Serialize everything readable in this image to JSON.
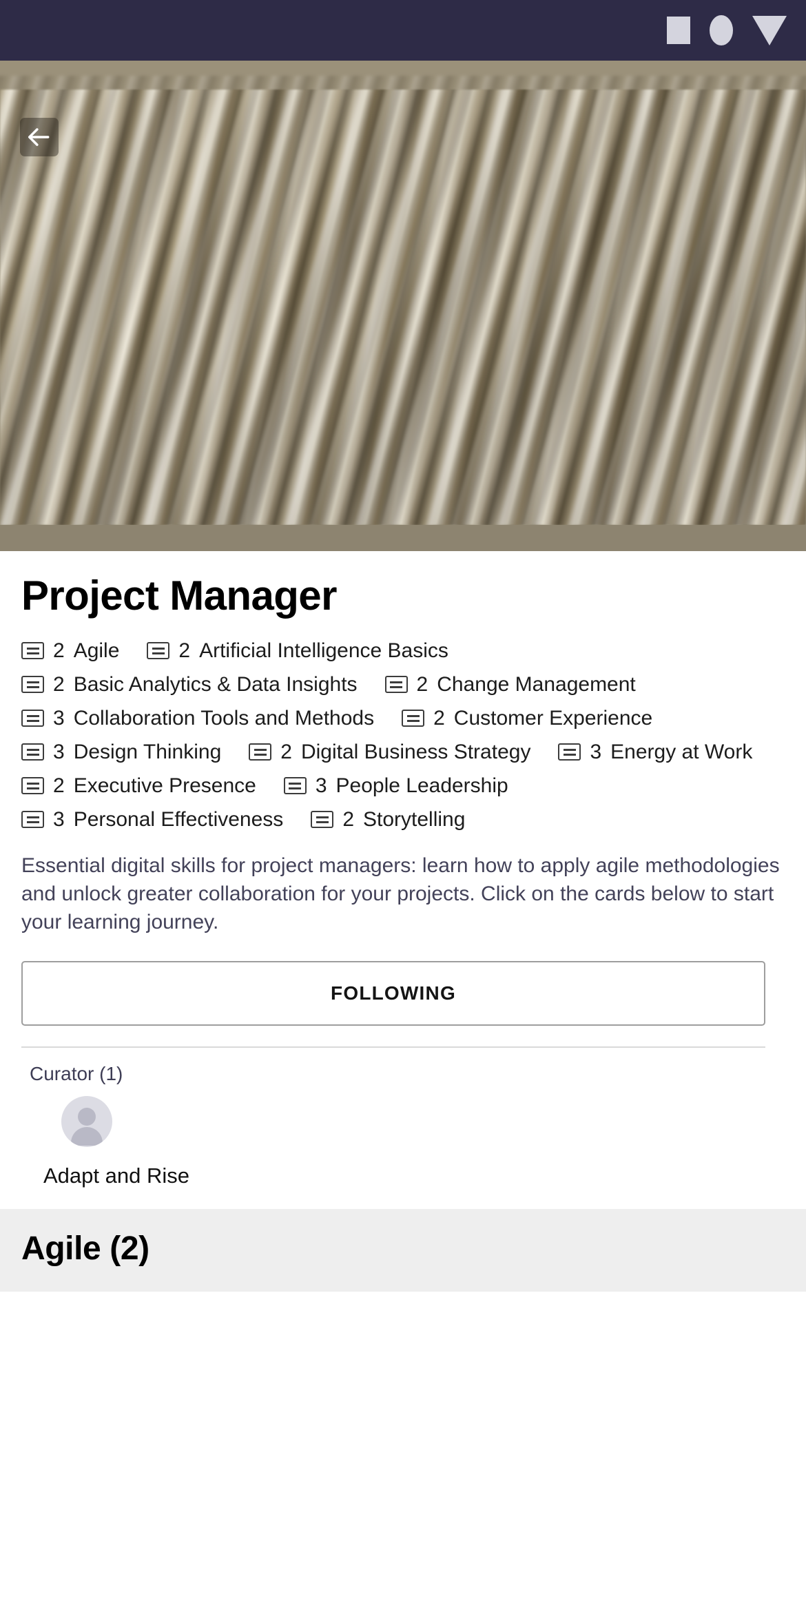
{
  "statusbar": {
    "background_color": "#2e2b47",
    "icons": [
      "square-icon",
      "circle-icon",
      "triangle-down-icon"
    ]
  },
  "hero": {
    "image_description": "sand ripples",
    "back_button_label": "Back",
    "back_icon": "arrow-left-icon"
  },
  "page": {
    "title": "Project Manager",
    "description": "Essential digital skills for project managers: learn how to apply agile methodologies and unlock greater collaboration for your projects. Click on the cards below to start your learning journey.",
    "accent_text_color": "#434259"
  },
  "skills": [
    {
      "count": "2",
      "label": "Agile"
    },
    {
      "count": "2",
      "label": "Artificial Intelligence Basics"
    },
    {
      "count": "2",
      "label": "Basic Analytics & Data Insights"
    },
    {
      "count": "2",
      "label": "Change Management"
    },
    {
      "count": "3",
      "label": "Collaboration Tools and Methods"
    },
    {
      "count": "2",
      "label": "Customer Experience"
    },
    {
      "count": "3",
      "label": "Design Thinking"
    },
    {
      "count": "2",
      "label": "Digital Business Strategy"
    },
    {
      "count": "3",
      "label": "Energy at Work"
    },
    {
      "count": "2",
      "label": "Executive Presence"
    },
    {
      "count": "3",
      "label": "People Leadership"
    },
    {
      "count": "3",
      "label": "Personal Effectiveness"
    },
    {
      "count": "2",
      "label": "Storytelling"
    }
  ],
  "follow": {
    "label": "FOLLOWING"
  },
  "curator": {
    "heading": "Curator (1)",
    "name": "Adapt and Rise",
    "avatar_icon": "person-placeholder-icon"
  },
  "next_section": {
    "title": "Agile (2)"
  }
}
